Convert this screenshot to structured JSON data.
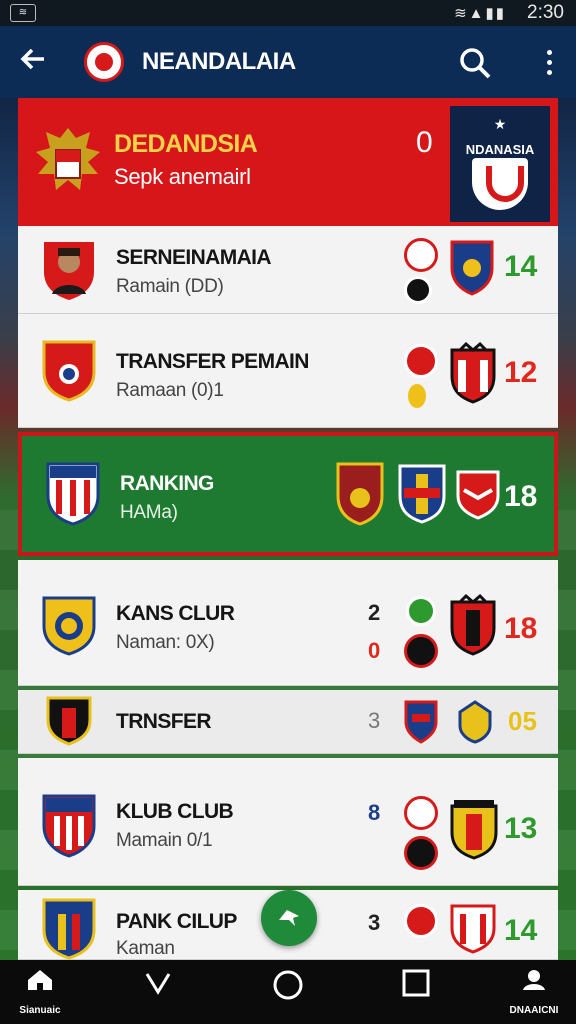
{
  "status_bar": {
    "time": "2:30"
  },
  "toolbar": {
    "title": "NEANDALAIA"
  },
  "header": {
    "name": "DEDANDSIA",
    "sub": "Sepk anemairl",
    "value": "0",
    "badge_label": "NDANASIA"
  },
  "rows": [
    {
      "name": "SERNEINAMAIA",
      "sub": "Ramain (DD)",
      "mid": "",
      "value": "14",
      "value_color": "#2e9a2e"
    },
    {
      "name": "TRANSFER PEMAIN",
      "sub": "Ramaan (0)1",
      "mid": "",
      "value": "12",
      "value_color": "#e0281e"
    },
    {
      "name": "RANKING",
      "sub": "HAMa)",
      "mid": "",
      "value": "18",
      "value_color": "#ffffff"
    },
    {
      "name": "KANS CLUR",
      "sub": "Naman: 0X)",
      "mid_top": "2",
      "mid_bottom": "0",
      "value": "18",
      "value_color": "#e0281e"
    },
    {
      "name": "TRNSFER",
      "sub": "",
      "mid": "3",
      "value": "05",
      "value_color": "#e8c21a"
    },
    {
      "name": "KLUB CLUB",
      "sub": "Mamain 0/1",
      "mid": "8",
      "value": "13",
      "value_color": "#2e9a2e"
    },
    {
      "name": "PANK CILUP",
      "sub": "Kaman",
      "mid": "3",
      "value": "14",
      "value_color": "#2e9a2e"
    }
  ],
  "nav": {
    "home_label": "Sianuaic",
    "profile_label": "DNAAICNI"
  },
  "colors": {
    "toolbar": "#0d2c55",
    "header": "#d7161a",
    "selected": "#1e7a30",
    "accent": "#f6d24a"
  },
  "icons": [
    "back-arrow-icon",
    "search-icon",
    "more-vert-icon",
    "home-icon",
    "back-nav-icon",
    "circle-home-icon",
    "recents-icon",
    "profile-icon",
    "add-icon"
  ]
}
